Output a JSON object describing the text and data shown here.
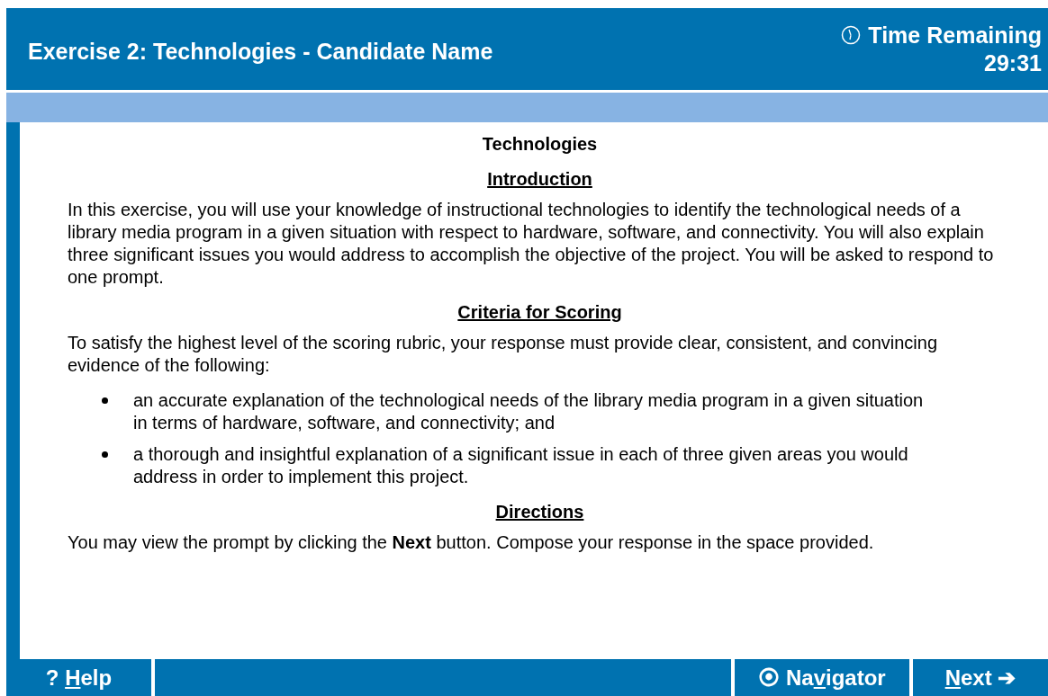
{
  "header": {
    "title": "Exercise 2: Technologies - Candidate Name",
    "timer_label": "Time Remaining",
    "timer_value": "29:31"
  },
  "content": {
    "heading": "Technologies",
    "sections": [
      {
        "kind": "subheading",
        "text": "Introduction"
      },
      {
        "kind": "paragraph",
        "text": "In this exercise, you will use your knowledge of instructional technologies to identify the technological needs of a library media program in a given situation with respect to hardware, software, and connectivity. You will also explain three significant issues you would address to accomplish the objective of the project. You will be asked to respond to one prompt."
      },
      {
        "kind": "subheading",
        "text": "Criteria for Scoring"
      },
      {
        "kind": "paragraph",
        "text": "To satisfy the highest level of the scoring rubric, your response must provide clear, consistent, and convincing evidence of the following:"
      },
      {
        "kind": "bullets",
        "items": [
          "an accurate explanation of the technological needs of the library media program in a given situation in terms of hardware, software, and connectivity; and",
          "a thorough and insightful explanation of a significant issue in each of three given areas you would address in order to implement this project."
        ]
      },
      {
        "kind": "subheading",
        "text": "Directions"
      },
      {
        "kind": "paragraph",
        "text": "You may view the prompt by clicking the **Next** button. Compose your response in the space provided."
      }
    ]
  },
  "footer": {
    "help": {
      "icon": "?",
      "key": "H",
      "after": "elp"
    },
    "navigator": {
      "icon": "⦿",
      "before": "Na",
      "key": "v",
      "after": "igator"
    },
    "next": {
      "key": "N",
      "after": "ext",
      "icon": "➔"
    }
  }
}
